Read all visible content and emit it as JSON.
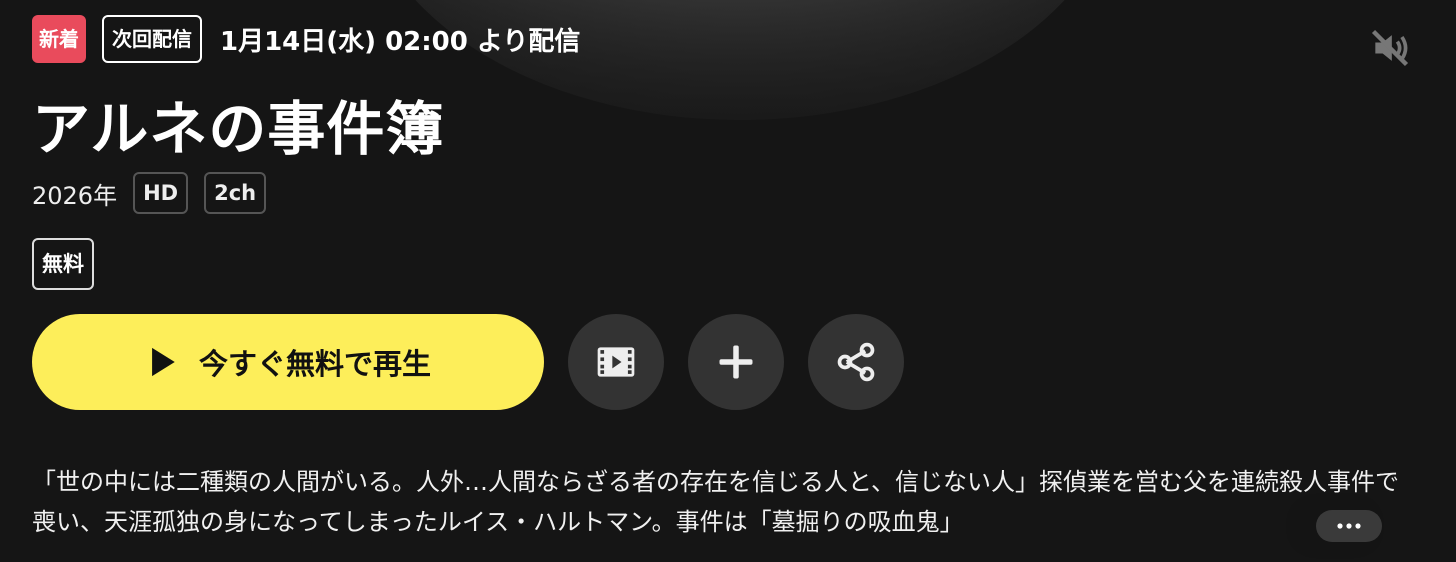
{
  "header": {
    "new_badge": "新着",
    "next_badge": "次回配信",
    "next_date": "1月14日(水) 02:00 より配信",
    "mute_icon": "volume-muted-icon"
  },
  "title": "アルネの事件簿",
  "meta": {
    "year": "2026年",
    "quality": "HD",
    "audio": "2ch"
  },
  "price_tag": "無料",
  "actions": {
    "play_label": "今すぐ無料で再生",
    "play_icon": "play-icon",
    "trailer_icon": "film-icon",
    "add_icon": "plus-icon",
    "share_icon": "share-icon"
  },
  "description": "「世の中には二種類の人間がいる。人外…人間ならざる者の存在を信じる人と、信じない人」探偵業を営む父を連続殺人事件で喪い、天涯孤独の身になってしまったルイス・ハルトマン。事件は「墓掘りの吸血鬼」",
  "more_icon": "more-horizontal-icon",
  "colors": {
    "background": "#151515",
    "play_button": "#fdee5a",
    "new_badge": "#e94b5c",
    "circle_button": "#333333"
  }
}
